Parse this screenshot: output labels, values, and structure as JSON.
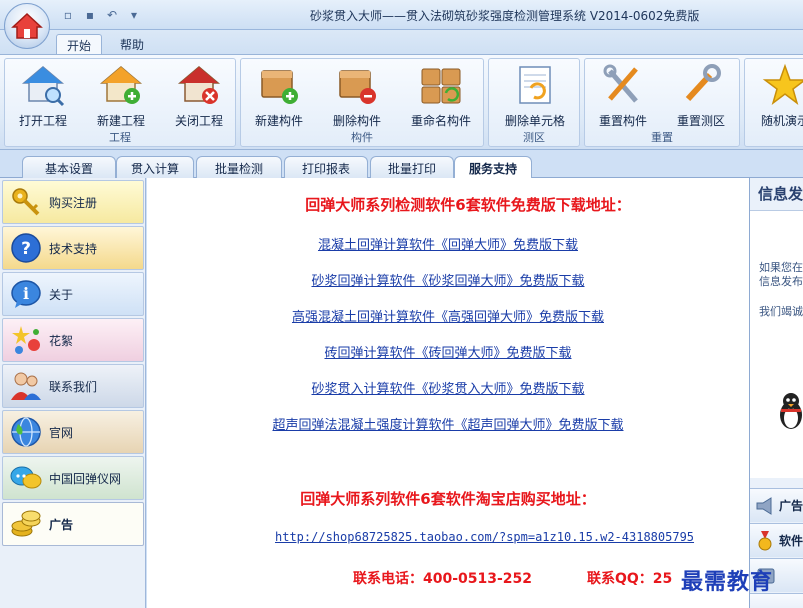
{
  "window": {
    "title": "砂浆贯入大师——贯入法砌筑砂浆强度检测管理系统  V2014-0602免费版"
  },
  "ribbon_tabs": [
    "开始",
    "帮助"
  ],
  "ribbon": {
    "groups": [
      {
        "label": "工程",
        "buttons": [
          "打开工程",
          "新建工程",
          "关闭工程"
        ]
      },
      {
        "label": "构件",
        "buttons": [
          "新建构件",
          "删除构件",
          "重命名构件"
        ]
      },
      {
        "label": "测区",
        "buttons": [
          "删除单元格"
        ]
      },
      {
        "label": "重置",
        "buttons": [
          "重置构件",
          "重置测区"
        ]
      },
      {
        "label": "",
        "buttons": [
          "随机演示"
        ]
      }
    ]
  },
  "sub_tabs": [
    "基本设置",
    "贯入计算",
    "批量检测",
    "打印报表",
    "批量打印",
    "服务支持"
  ],
  "left_nav": [
    {
      "label": "购买注册",
      "icon": "key-icon"
    },
    {
      "label": "技术支持",
      "icon": "help-icon"
    },
    {
      "label": "关于",
      "icon": "info-icon"
    },
    {
      "label": "花絮",
      "icon": "sparkle-icon"
    },
    {
      "label": "联系我们",
      "icon": "people-icon"
    },
    {
      "label": "官网",
      "icon": "globe-icon"
    },
    {
      "label": "中国回弹仪网",
      "icon": "chat-icon"
    },
    {
      "label": "广告",
      "icon": "coins-icon"
    }
  ],
  "main": {
    "heading_download": "回弹大师系列检测软件6套软件免费版下载地址：",
    "links": [
      "混凝土回弹计算软件《回弹大师》免费版下载",
      "砂浆回弹计算软件《砂浆回弹大师》免费版下载",
      "高强混凝土回弹计算软件《高强回弹大师》免费版下载",
      "砖回弹计算软件《砖回弹大师》免费版下载",
      "砂浆贯入计算软件《砂浆贯入大师》免费版下载",
      "超声回弹法混凝土强度计算软件《超声回弹大师》免费版下载"
    ],
    "heading_shop": "回弹大师系列软件6套软件淘宝店购买地址：",
    "shop_url": "http://shop68725825.taobao.com/?spm=a1z10.15.w2-4318805795",
    "phone": "联系电话：400-0513-252",
    "qq": "联系QQ：25"
  },
  "right_panel": {
    "title": "信息发",
    "text_lines": [
      "如果您在",
      "信息发布",
      "我们竭诚"
    ],
    "tabs": [
      "广告",
      "软件",
      ""
    ]
  },
  "watermark": "最需教育"
}
